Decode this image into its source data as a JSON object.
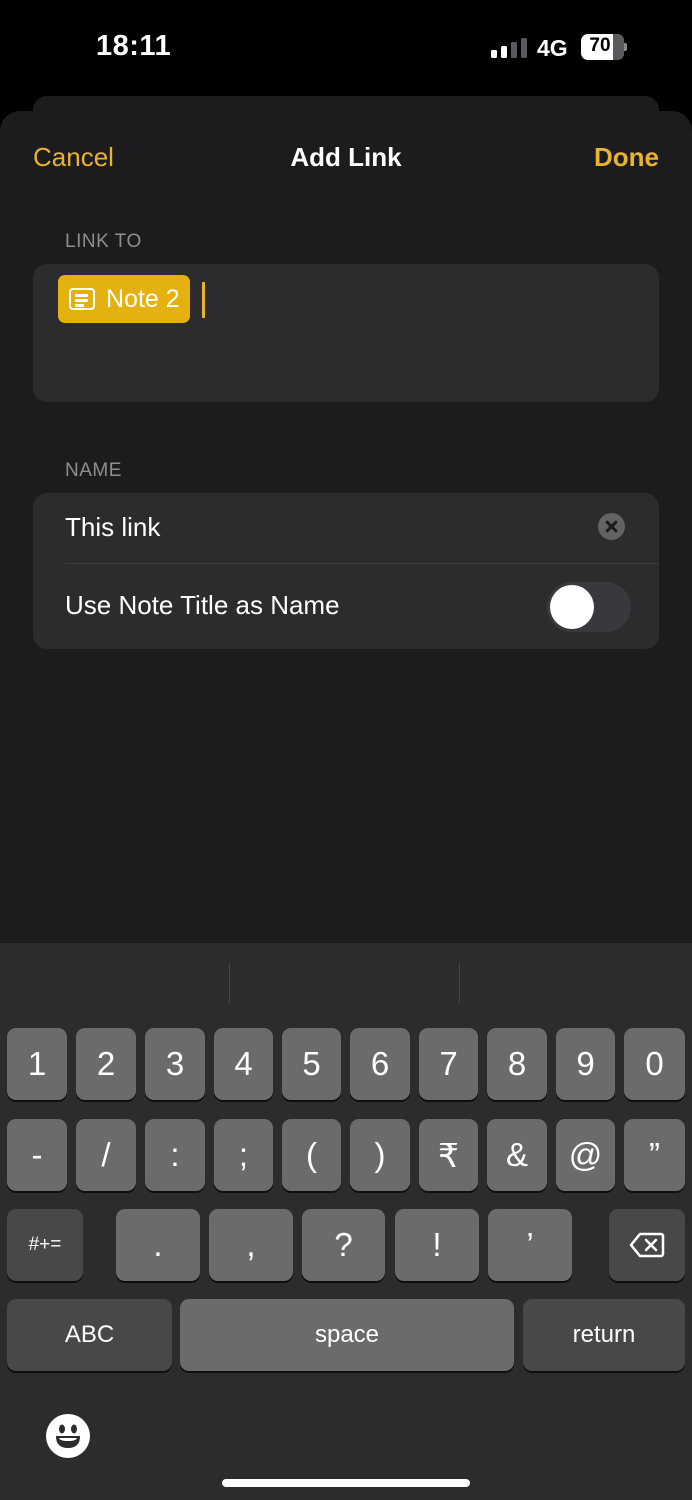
{
  "status_bar": {
    "time": "18:11",
    "network": "4G",
    "battery": "70"
  },
  "nav": {
    "cancel_label": "Cancel",
    "title": "Add Link",
    "done_label": "Done"
  },
  "link_to": {
    "section_label": "LINK TO",
    "chip_label": "Note 2"
  },
  "name": {
    "section_label": "NAME",
    "value": "This link",
    "toggle_label": "Use Note Title as Name",
    "toggle_on": false
  },
  "keyboard": {
    "row1": [
      "1",
      "2",
      "3",
      "4",
      "5",
      "6",
      "7",
      "8",
      "9",
      "0"
    ],
    "row2": [
      "-",
      "/",
      ":",
      ";",
      "(",
      ")",
      "₹",
      "&",
      "@",
      "”"
    ],
    "row3_mode": "#+=",
    "row3": [
      ".",
      ",",
      "?",
      "!",
      "’"
    ],
    "abc_label": "ABC",
    "space_label": "space",
    "return_label": "return"
  },
  "colors": {
    "accent": "#e8b232",
    "chip": "#e5b10f",
    "background": "#1c1c1e",
    "card": "#2c2c2e"
  }
}
